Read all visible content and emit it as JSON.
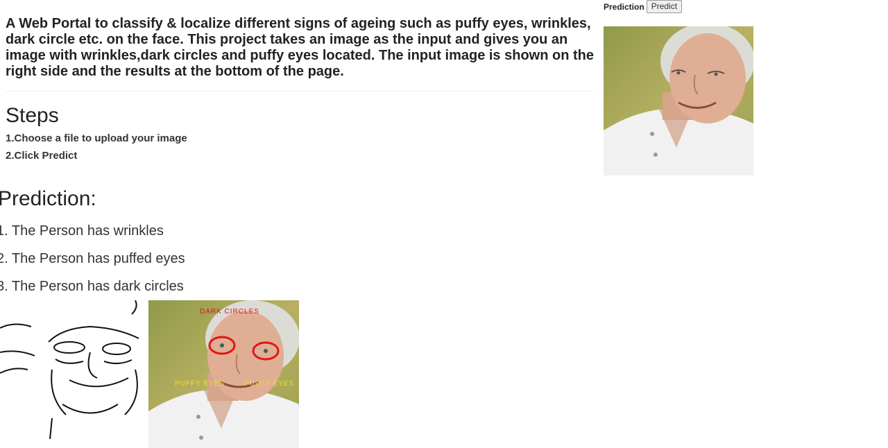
{
  "description": "A Web Portal to classify & localize different signs of ageing such as puffy eyes, wrinkles, dark circle etc. on the face. This project takes an image as the input and gives you an image with wrinkles,dark circles and puffy eyes located. The input image is shown on the right side and the results at the bottom of the page.",
  "steps": {
    "title": "Steps",
    "items": [
      "1.Choose a file to upload your image",
      "2.Click Predict"
    ]
  },
  "prediction": {
    "title": "Prediction:",
    "results": [
      "1. The Person has wrinkles",
      "2. The Person has puffed eyes",
      "3. The Person has dark circles"
    ]
  },
  "form": {
    "label": "Prediction",
    "button_label": "Predict"
  },
  "output_annotations": {
    "dark_circles": "DARK CIRCLES",
    "puffy_eyes_left": "PUFFY EYES",
    "puffy_eyes_right": "PUFFY EYES"
  }
}
